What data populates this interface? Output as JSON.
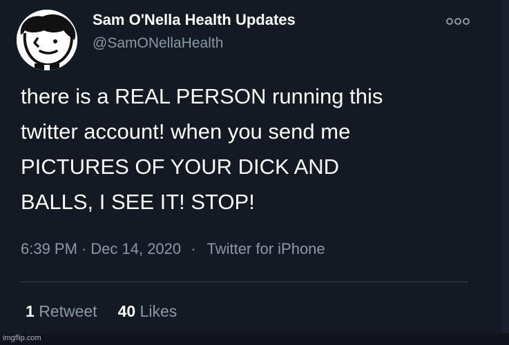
{
  "author": {
    "display_name": "Sam O'Nella Health Updates",
    "handle": "@SamONellaHealth",
    "avatar_icon": "cartoon-face-avatar"
  },
  "more_icon": "more-options-icon",
  "tweet": {
    "text_lines": [
      "there is a REAL PERSON running this",
      "twitter account! when you send me",
      "PICTURES OF YOUR DICK AND",
      "BALLS, I SEE IT! STOP!"
    ],
    "time": "6:39 PM",
    "date": "Dec 14, 2020",
    "source": "Twitter for iPhone",
    "retweet_count": "1",
    "retweet_label": "Retweet",
    "like_count": "40",
    "like_label": "Likes"
  },
  "watermark": "imgflip.com",
  "colors": {
    "background": "#141a24",
    "text": "#ffffff",
    "muted": "#8b98a5",
    "divider": "#38444d"
  }
}
